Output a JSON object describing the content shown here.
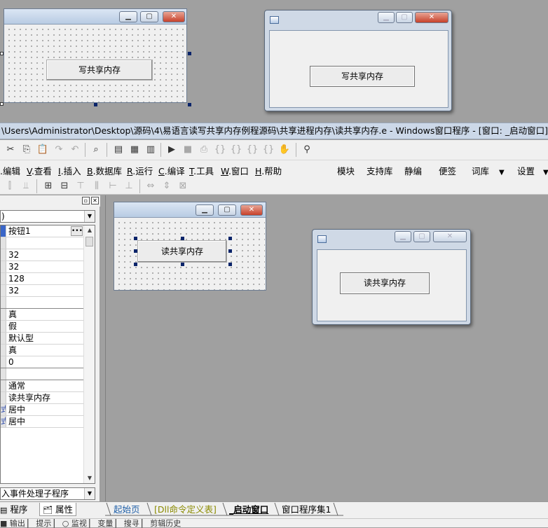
{
  "top_preview": {
    "design_window": {
      "button_label": "写共享内存",
      "caption_icons": [
        "minimize-icon",
        "maximize-icon",
        "close-icon"
      ]
    },
    "run_window": {
      "button_label": "写共享内存",
      "caption_icons": [
        "minimize-icon",
        "maximize-icon",
        "close-icon"
      ]
    }
  },
  "titlebar": {
    "text": "\\Users\\Administrator\\Desktop\\源码\\4\\易语言读写共享内存例程源码\\共享进程内存\\读共享内存.e - Windows窗口程序 - [窗口: _启动窗口]"
  },
  "menu": {
    "items": [
      {
        "key": "",
        "label": ".编辑"
      },
      {
        "key": "V",
        "label": ".查看"
      },
      {
        "key": "I",
        "label": ".插入"
      },
      {
        "key": "B",
        "label": ".数据库"
      },
      {
        "key": "R",
        "label": ".运行"
      },
      {
        "key": "C",
        "label": ".编译"
      },
      {
        "key": "T",
        "label": ".工具"
      },
      {
        "key": "W",
        "label": ".窗口"
      },
      {
        "key": "H",
        "label": ".帮助"
      }
    ],
    "right_items": [
      "模块",
      "支持库",
      "静编",
      "便签",
      "词库",
      "设置"
    ]
  },
  "properties": {
    "object_combo": ")",
    "rows": [
      "按钮1",
      "",
      "32",
      "32",
      "128",
      "32",
      "",
      "真",
      "假",
      "默认型",
      "真",
      "0",
      "",
      "通常",
      "读共享内存",
      "居中",
      "居中"
    ],
    "row_keys": [
      "",
      "",
      "",
      "",
      "",
      "",
      "",
      "",
      "",
      "",
      "",
      "",
      "",
      "",
      "",
      "式",
      "式"
    ],
    "event_combo": "入事件处理子程序",
    "tabs": [
      "程序",
      "属性"
    ]
  },
  "workspace": {
    "design_window": {
      "button_label": "读共享内存"
    },
    "run_window": {
      "button_label": "读共享内存"
    }
  },
  "doc_tabs": [
    {
      "label": "起始页"
    },
    {
      "label": "[Dll命令定义表]"
    },
    {
      "label": "_启动窗口"
    },
    {
      "label": "窗口程序集1"
    }
  ],
  "status": {
    "text": "■ 输出 ▏ 提示 ▏ ○ 监视 ▏ 变量 ▏ 搜寻 ▏ 剪辑历史"
  }
}
